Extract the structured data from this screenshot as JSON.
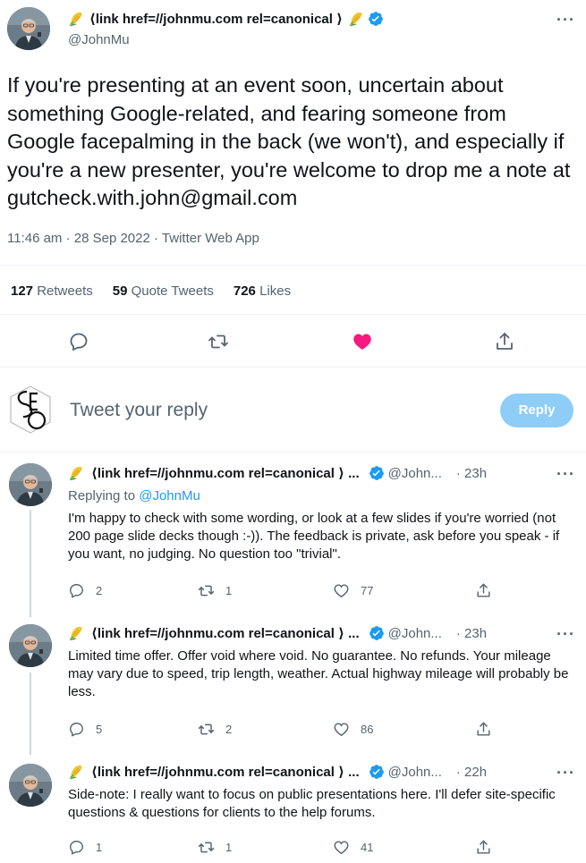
{
  "main_tweet": {
    "display_name": "⟨link href=//johnmu.com rel=canonical ⟩",
    "handle": "@JohnMu",
    "text": "If you're presenting at an event soon, uncertain about something Google-related, and fearing someone from Google facepalming in the back (we won't), and especially if you're a new presenter, you're welcome to drop me a note at gutcheck.with.john@gmail.com",
    "meta": "11:46 am · 28 Sep 2022 · Twitter Web App",
    "stats": {
      "retweets_count": "127",
      "retweets_label": "Retweets",
      "quotes_count": "59",
      "quotes_label": "Quote Tweets",
      "likes_count": "726",
      "likes_label": "Likes"
    },
    "like_color": "#f91880"
  },
  "composer": {
    "placeholder": "Tweet your reply",
    "button_label": "Reply"
  },
  "replies": [
    {
      "display_name": "⟨link href=//johnmu.com rel=canonical ⟩ ...",
      "handle": "@John...",
      "time": "· 23h",
      "replying_prefix": "Replying to",
      "replying_handle": "@JohnMu",
      "text": "I'm happy to check with some wording, or look at a few slides if you're worried (not 200 page slide decks though :-)). The feedback is private, ask before you speak - if you want, no judging. No question too \"trivial\".",
      "replies": "2",
      "retweets": "1",
      "likes": "77"
    },
    {
      "display_name": "⟨link href=//johnmu.com rel=canonical ⟩ ...",
      "handle": "@John...",
      "time": "· 23h",
      "text": "Limited time offer. Offer void where void. No guarantee. No refunds. Your mileage may vary due to speed, trip length, weather. Actual highway mileage will probably be less.",
      "replies": "5",
      "retweets": "2",
      "likes": "86"
    },
    {
      "display_name": "⟨link href=//johnmu.com rel=canonical ⟩ ...",
      "handle": "@John...",
      "time": "· 22h",
      "text": "Side-note: I really want to focus on public presentations here. I'll defer site-specific questions & questions for clients to the help forums.",
      "replies": "1",
      "retweets": "1",
      "likes": "41"
    }
  ],
  "accent_color": "#1d9bf0",
  "icons": [
    "corn-emoji-icon",
    "verified-badge-icon",
    "more-icon",
    "reply-icon",
    "retweet-icon",
    "like-icon",
    "share-icon",
    "seo-logo-icon"
  ]
}
